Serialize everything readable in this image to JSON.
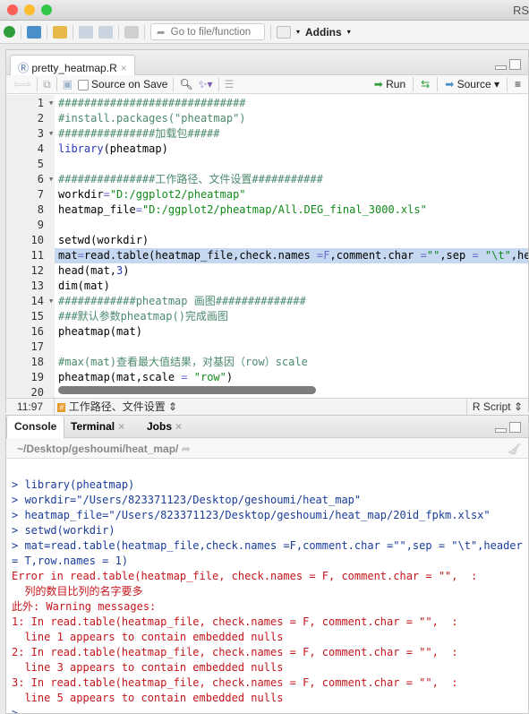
{
  "window": {
    "title": "RS",
    "controls": [
      "#fc5f57",
      "#fdbc2e",
      "#33c748"
    ]
  },
  "toolbar": {
    "goto_placeholder": "Go to file/function",
    "addins": "Addins"
  },
  "editor": {
    "tab": "pretty_heatmap.R",
    "source_on_save": "Source on Save",
    "run": "Run",
    "source": "Source",
    "lines": [
      {
        "n": "1",
        "fold": true,
        "seg": [
          [
            "#############################",
            "cm"
          ]
        ]
      },
      {
        "n": "2",
        "seg": [
          [
            "#install.packages(\"pheatmap\")",
            "cm"
          ]
        ]
      },
      {
        "n": "3",
        "fold": true,
        "seg": [
          [
            "###############加载包#####",
            "cm"
          ]
        ]
      },
      {
        "n": "4",
        "seg": [
          [
            "library",
            "kw"
          ],
          [
            "(pheatmap)",
            ""
          ]
        ]
      },
      {
        "n": "5",
        "seg": []
      },
      {
        "n": "6",
        "fold": true,
        "seg": [
          [
            "###############工作路径、文件设置###########",
            "cm"
          ]
        ]
      },
      {
        "n": "7",
        "seg": [
          [
            "workdir",
            ""
          ],
          [
            "=",
            "op"
          ],
          [
            "\"D:/ggplot2/pheatmap\"",
            "st"
          ]
        ]
      },
      {
        "n": "8",
        "seg": [
          [
            "heatmap_file",
            ""
          ],
          [
            "=",
            "op"
          ],
          [
            "\"D:/ggplot2/pheatmap/All.DEG_final_3000.xls\"",
            "st"
          ]
        ]
      },
      {
        "n": "9",
        "seg": []
      },
      {
        "n": "10",
        "seg": [
          [
            "setwd(workdir)",
            ""
          ]
        ]
      },
      {
        "n": "11",
        "hl": true,
        "seg": [
          [
            "mat",
            ""
          ],
          [
            "=",
            "op"
          ],
          [
            "read.table(heatmap_file,check.names ",
            ""
          ],
          [
            "=F",
            "op"
          ],
          [
            ",comment.char ",
            ""
          ],
          [
            "=",
            "op"
          ],
          [
            "\"\"",
            "st"
          ],
          [
            ",sep ",
            ""
          ],
          [
            "=",
            "op"
          ],
          [
            " \"\\t\"",
            "st"
          ],
          [
            ",he",
            ""
          ]
        ]
      },
      {
        "n": "12",
        "seg": [
          [
            "head(mat,",
            ""
          ],
          [
            "3",
            "nm"
          ],
          [
            ")",
            ""
          ]
        ]
      },
      {
        "n": "13",
        "seg": [
          [
            "dim(mat)",
            ""
          ]
        ]
      },
      {
        "n": "14",
        "fold": true,
        "seg": [
          [
            "############pheatmap 画图##############",
            "cm"
          ]
        ]
      },
      {
        "n": "15",
        "seg": [
          [
            "###默认参数pheatmap()完成画图",
            "cm"
          ]
        ]
      },
      {
        "n": "16",
        "seg": [
          [
            "pheatmap(mat)",
            ""
          ]
        ]
      },
      {
        "n": "17",
        "seg": []
      },
      {
        "n": "18",
        "seg": [
          [
            "#max(mat)查看最大值结果，对基因（row）scale",
            "cm"
          ]
        ]
      },
      {
        "n": "19",
        "seg": [
          [
            "pheatmap(mat,scale ",
            ""
          ],
          [
            "=",
            "op"
          ],
          [
            " \"row\"",
            "st"
          ],
          [
            ")",
            ""
          ]
        ]
      },
      {
        "n": "20",
        "seg": []
      }
    ],
    "status": {
      "position": "11:97",
      "section": "工作路径、文件设置",
      "filetype": "R Script"
    }
  },
  "console": {
    "tabs": [
      "Console",
      "Terminal",
      "Jobs"
    ],
    "path": "~/Desktop/geshoumi/heat_map/",
    "lines": [
      [
        "> library(pheatmap)",
        "cmd"
      ],
      [
        "> workdir=\"/Users/823371123/Desktop/geshoumi/heat_map\"",
        "cmd"
      ],
      [
        "> heatmap_file=\"/Users/823371123/Desktop/geshoumi/heat_map/20id_fpkm.xlsx\"",
        "cmd"
      ],
      [
        "> setwd(workdir)",
        "cmd"
      ],
      [
        "> mat=read.table(heatmap_file,check.names =F,comment.char =\"\",sep = \"\\t\",header",
        "cmd"
      ],
      [
        "= T,row.names = 1)",
        "cmd"
      ],
      [
        "Error in read.table(heatmap_file, check.names = F, comment.char = \"\",  :",
        "err"
      ],
      [
        "  列的数目比列的名字要多",
        "err"
      ],
      [
        "此外: Warning messages:",
        "err"
      ],
      [
        "1: In read.table(heatmap_file, check.names = F, comment.char = \"\",  :",
        "err"
      ],
      [
        "  line 1 appears to contain embedded nulls",
        "err"
      ],
      [
        "2: In read.table(heatmap_file, check.names = F, comment.char = \"\",  :",
        "err"
      ],
      [
        "  line 3 appears to contain embedded nulls",
        "err"
      ],
      [
        "3: In read.table(heatmap_file, check.names = F, comment.char = \"\",  :",
        "err"
      ],
      [
        "  line 5 appears to contain embedded nulls",
        "err"
      ],
      [
        ">",
        "cmd"
      ]
    ]
  }
}
